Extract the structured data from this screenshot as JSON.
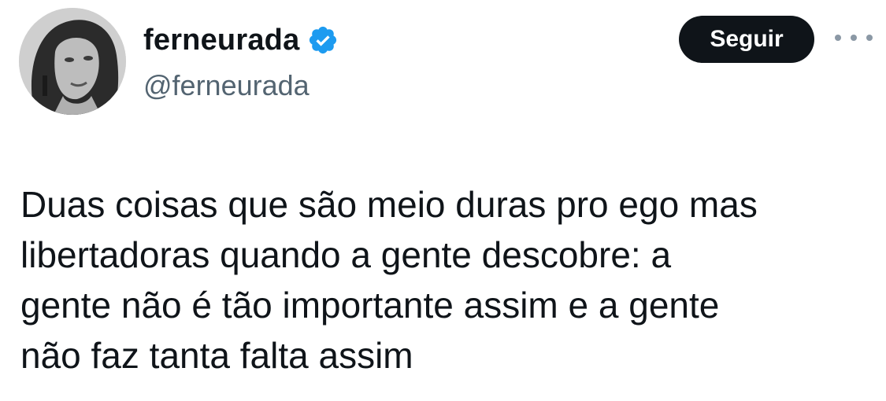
{
  "tweet": {
    "author": {
      "display_name": "ferneurada",
      "handle": "@ferneurada",
      "verified": true,
      "avatar_icon": "profile-photo"
    },
    "actions": {
      "follow_label": "Seguir",
      "more_icon": "more-horizontal-icon"
    },
    "text_lines": [
      "Duas coisas que são meio duras pro ego mas",
      "libertadoras quando a gente descobre: a",
      "gente não é tão importante assim e a gente",
      "não faz tanta falta assim"
    ]
  },
  "colors": {
    "text_primary": "#0f1419",
    "text_secondary": "#536471",
    "verified_badge": "#1d9bf0",
    "button_bg": "#0f1419",
    "button_text": "#ffffff"
  }
}
